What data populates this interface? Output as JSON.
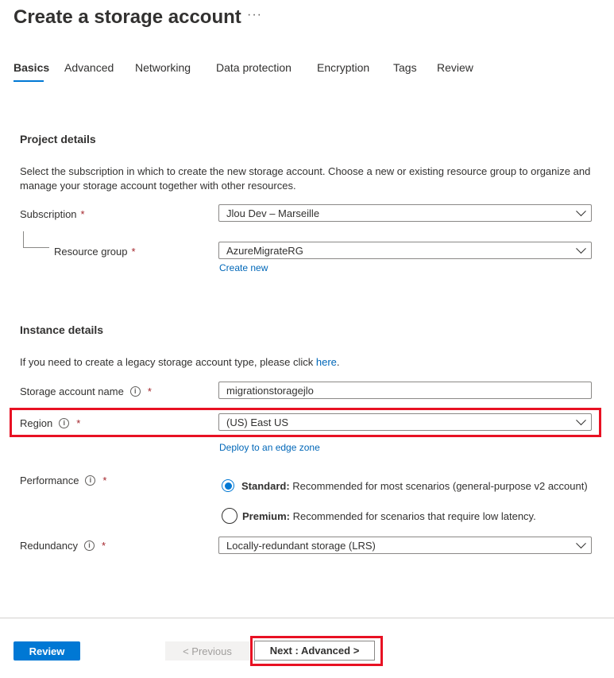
{
  "page": {
    "title": "Create a storage account",
    "more": "···"
  },
  "tabs": [
    "Basics",
    "Advanced",
    "Networking",
    "Data protection",
    "Encryption",
    "Tags",
    "Review"
  ],
  "project": {
    "title": "Project details",
    "description": "Select the subscription in which to create the new storage account. Choose a new or existing resource group to organize and manage your storage account together with other resources.",
    "subscription_label": "Subscription",
    "subscription_value": "Jlou Dev – Marseille",
    "resource_group_label": "Resource group",
    "resource_group_value": "AzureMigrateRG",
    "create_new": "Create new",
    "required_mark": "*"
  },
  "instance": {
    "title": "Instance details",
    "legacy_text": "If you need to create a legacy storage account type, please click ",
    "legacy_link": "here",
    "legacy_period": ".",
    "name_label": "Storage account name",
    "name_value": "migrationstoragejlo",
    "region_label": "Region",
    "region_value": "(US) East US",
    "edge_zone_link": "Deploy to an edge zone",
    "performance_label": "Performance",
    "standard_title": "Standard:",
    "standard_desc": " Recommended for most scenarios (general-purpose v2 account)",
    "premium_title": "Premium:",
    "premium_desc": " Recommended for scenarios that require low latency.",
    "redundancy_label": "Redundancy",
    "redundancy_value": "Locally-redundant storage (LRS)",
    "info_glyph": "i"
  },
  "footer": {
    "review": "Review",
    "previous": "< Previous",
    "next": "Next : Advanced >"
  }
}
